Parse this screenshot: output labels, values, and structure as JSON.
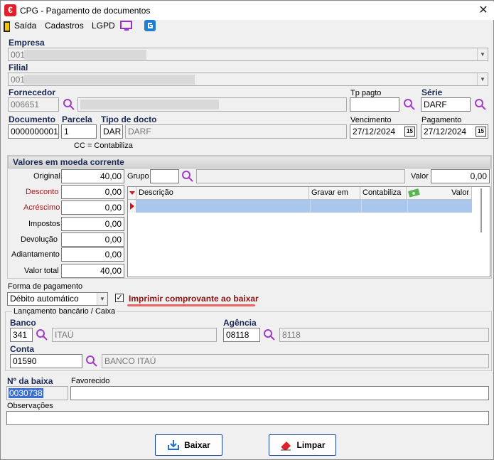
{
  "window": {
    "title": "CPG - Pagamento de documentos",
    "close_glyph": "✕"
  },
  "menu": {
    "exit": "Saída",
    "registries": "Cadastros",
    "lgpd": "LGPD"
  },
  "empresa": {
    "label": "Empresa",
    "code": "001"
  },
  "filial": {
    "label": "Filial",
    "code": "001"
  },
  "fornecedor": {
    "label": "Fornecedor",
    "code": "006651"
  },
  "tp_pagto": {
    "label": "Tp pagto",
    "value": ""
  },
  "serie": {
    "label": "Série",
    "value": "DARF"
  },
  "documento": {
    "label": "Documento",
    "value": "0000000001"
  },
  "parcela": {
    "label": "Parcela",
    "value": "1"
  },
  "tipo_docto": {
    "label": "Tipo de docto",
    "code": "DAR",
    "desc": "DARF"
  },
  "vencimento": {
    "label": "Vencimento",
    "value": "27/12/2024"
  },
  "pagamento": {
    "label": "Pagamento",
    "value": "27/12/2024"
  },
  "calendar_glyph": "15",
  "cc_note": "CC = Contabiliza",
  "valores": {
    "title": "Valores em moeda corrente",
    "original_label": "Original",
    "original": "40,00",
    "desconto_label": "Desconto",
    "desconto": "0,00",
    "acrescimo_label": "Acréscimo",
    "acrescimo": "0,00",
    "impostos_label": "Impostos",
    "impostos": "0,00",
    "devolucao_label": "Devolução",
    "devolucao": "0,00",
    "adiantamento_label": "Adiantamento",
    "adiantamento": "0,00",
    "valor_total_label": "Valor total",
    "valor_total": "40,00",
    "grupo_label": "Grupo",
    "grupo": "",
    "valor_label": "Valor",
    "valor": "0,00",
    "grid_cols": [
      "Descrição",
      "Gravar em",
      "Contabiliza",
      "Valor"
    ]
  },
  "forma_pagamento": {
    "label": "Forma de pagamento",
    "value": "Débito automático"
  },
  "imprimir": {
    "label": "Imprimir comprovante ao baixar",
    "checked": true
  },
  "lancamento": {
    "title": "Lançamento bancário / Caixa",
    "banco_label": "Banco",
    "banco": "341",
    "banco_nome": "ITAÚ",
    "agencia_label": "Agência",
    "agencia": "08118",
    "agencia_desc": "8118",
    "conta_label": "Conta",
    "conta": "01590",
    "conta_desc": "BANCO ITAÚ"
  },
  "baixa": {
    "label": "Nº da baixa",
    "value": "0030738"
  },
  "favorecido": {
    "label": "Favorecido",
    "value": ""
  },
  "observacoes": {
    "label": "Observações",
    "value": ""
  },
  "buttons": {
    "baixar": "Baixar",
    "limpar": "Limpar"
  },
  "colors": {
    "accent_red": "#e0202a",
    "selection_blue": "#a9c7ec",
    "label_red": "#b01818"
  }
}
